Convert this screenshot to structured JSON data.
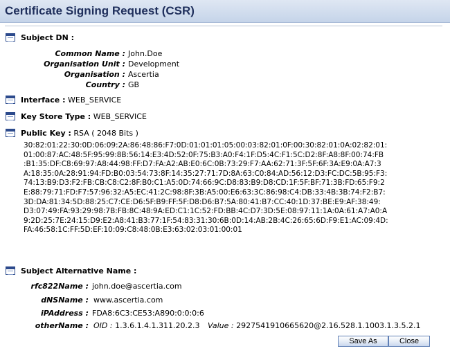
{
  "window": {
    "title": "Certificate Signing Request (CSR)"
  },
  "subject_dn": {
    "header": "Subject DN :",
    "fields": [
      {
        "label": "Common Name :",
        "value": "John.Doe"
      },
      {
        "label": "Organisation Unit :",
        "value": "Development"
      },
      {
        "label": "Organisation :",
        "value": "Ascertia"
      },
      {
        "label": "Country :",
        "value": "GB"
      }
    ]
  },
  "interface": {
    "label": "Interface :",
    "value": "WEB_SERVICE"
  },
  "key_store_type": {
    "label": "Key Store Type :",
    "value": "WEB_SERVICE"
  },
  "public_key": {
    "label": "Public Key :",
    "value": "RSA ( 2048 Bits )",
    "hex_lines": [
      "30:82:01:22:30:0D:06:09:2A:86:48:86:F7:0D:01:01:01:05:00:03:82:01:0F:00:30:82:01:0A:02:82:01:",
      "01:00:87:AC:48:5F:95:99:8B:56:14:E3:4D:52:0F:75:B3:A0:F4:1F:D5:4C:F1:5C:D2:8F:A8:8F:00:74:FB",
      ":B1:35:DF:C8:69:97:A8:44:98:FF:D7:FA:A2:AB:E0:6C:0B:73:29:F7:AA:62:71:3F:5F:6F:3A:E9:0A:A7:3",
      "A:18:35:0A:28:91:94:FD:B0:03:54:73:8F:14:35:27:71:7D:8A:63:C0:84:AD:56:12:D3:FC:DC:5B:95:F3:",
      "74:13:B9:D3:F2:FB:CB:C8:C2:8F:B0:C1:A5:0D:74:66:9C:D8:83:B9:D8:CD:1F:5F:BF:71:3B:FD:65:F9:2",
      "E:88:79:71:FD:F7:57:96:32:A5:EC:41:2C:98:8F:3B:A5:00:E6:63:3C:86:98:C4:DB:33:4B:3B:74:F2:B7:",
      "3D:DA:81:34:5D:88:25:C7:CE:D6:5F:B9:FF:5F:D8:D6:B7:5A:80:41:B7:CC:40:1D:37:BE:E9:AF:38:49:",
      "D3:07:49:FA:93:29:98:7B:FB:8C:48:9A:ED:C1:1C:52:FD:BB:4C:D7:3D:5E:08:97:11:1A:0A:61:A7:A0:A",
      "9:2D:25:7E:24:15:D9:E2:A8:41:B3:77:1F:54:83:31:30:6B:0D:14:AB:2B:4C:26:65:6D:F9:E1:AC:09:4D:",
      "FA:46:58:1C:FF:5D:EF:10:09:C8:48:0B:E3:63:02:03:01:00:01"
    ]
  },
  "san": {
    "header": "Subject Alternative Name :",
    "fields": [
      {
        "label": "rfc822Name :",
        "value": "john.doe@ascertia.com"
      },
      {
        "label": "dNSName :",
        "value": "www.ascertia.com"
      },
      {
        "label": "iPAddress :",
        "value": "FDA8:6C3:CE53:A890:0:0:0:6"
      }
    ],
    "other_name": {
      "label": "otherName :",
      "oid_label": "OID :",
      "oid_value": "1.3.6.1.4.1.311.20.2.3",
      "value_label": "Value :",
      "value_value": "2927541910665620@2.16.528.1.1003.1.3.5.2.1"
    }
  },
  "buttons": {
    "save_as": "Save As",
    "close": "Close"
  },
  "icons": [
    "section-icon"
  ],
  "colors": {
    "title_text": "#1f2f5c",
    "titlebar_bg": "#c5d4e9",
    "button_border": "#5f7fb5"
  }
}
